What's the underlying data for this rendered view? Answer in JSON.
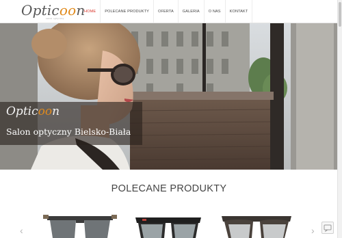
{
  "header": {
    "logo": {
      "part1": "Optic",
      "part2": "oo",
      "part3": "n",
      "sub": "salon optyczny"
    },
    "nav": [
      {
        "label": "HOME",
        "active": true
      },
      {
        "label": "POLECANE PRODUKTY"
      },
      {
        "label": "OFERTA"
      },
      {
        "label": "GALERIA"
      },
      {
        "label": "O NAS"
      },
      {
        "label": "KONTAKT"
      }
    ]
  },
  "hero": {
    "caption_logo": {
      "part1": "Optic",
      "part2": "oo",
      "part3": "n"
    },
    "caption_text": "Salon optyczny Bielsko-Biała"
  },
  "products": {
    "title": "POLECANE PRODUKTY",
    "prev_icon": "‹",
    "next_icon": "›",
    "items": [
      {
        "icon": "sunglasses-image"
      },
      {
        "icon": "sunglasses-image"
      },
      {
        "icon": "sunglasses-image"
      }
    ]
  },
  "colors": {
    "accent": "#e08a1c",
    "nav_active": "#d9352a"
  }
}
